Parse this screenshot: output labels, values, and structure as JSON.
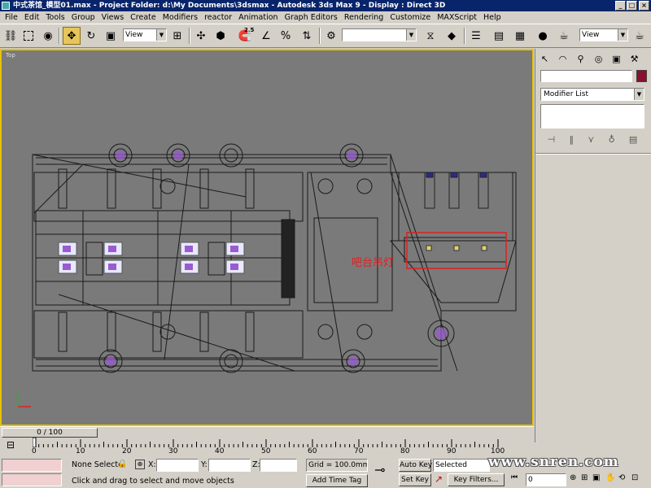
{
  "title": "中式茶馆_模型01.max    - Project Folder: d:\\My Documents\\3dsmax    - Autodesk 3ds Max 9    - Display : Direct 3D",
  "menu": [
    "File",
    "Edit",
    "Tools",
    "Group",
    "Views",
    "Create",
    "Modifiers",
    "reactor",
    "Animation",
    "Graph Editors",
    "Rendering",
    "Customize",
    "MAXScript",
    "Help"
  ],
  "toolbar": {
    "view_select": "View",
    "view_select2": "View",
    "spinner_label": "2.5",
    "named_selection": ""
  },
  "viewport": {
    "label": "Top",
    "annotation": "吧台吊灯",
    "accent": "#e8c200",
    "annotation_color": "#e02020"
  },
  "command_panel": {
    "modifier_list": "Modifier List",
    "object_color": "#8a1030"
  },
  "time_slider": {
    "value": "0 / 100"
  },
  "track_ticks": [
    "0",
    "10",
    "20",
    "30",
    "40",
    "50",
    "60",
    "70",
    "80",
    "90",
    "100"
  ],
  "status": {
    "selection": "None Selecte",
    "x_label": "X:",
    "y_label": "Y:",
    "z_label": "Z:",
    "grid": "Grid = 100.0mm",
    "prompt": "Click and drag to select and move objects",
    "add_time_tag": "Add Time Tag",
    "auto_key": "Auto Key",
    "set_key": "Set Key",
    "selected": "Selected",
    "key_filters": "Key Filters...",
    "frame": "0"
  },
  "watermark": "www.snren.com"
}
